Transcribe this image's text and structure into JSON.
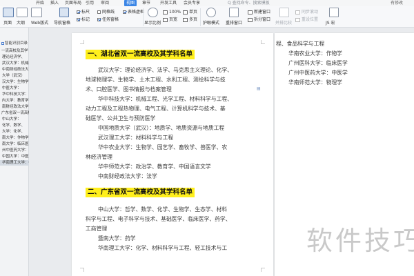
{
  "menu": {
    "items": [
      "开始",
      "插入",
      "页面布局",
      "引用",
      "审阅",
      "视图",
      "章节",
      "开发工具",
      "会员专享"
    ],
    "active_index": 5,
    "search": "Q 查找命令、搜索模板",
    "right": "有修改"
  },
  "ribbon": {
    "big_buttons": [
      "页面",
      "大纲",
      "Web版式"
    ],
    "nav_pane": "导航窗格",
    "checks": [
      "标尺",
      "网格线",
      "表格虚框",
      "标记",
      "任务窗格"
    ],
    "zoom_buttons": [
      "100%",
      "单页",
      "多页",
      "页宽"
    ],
    "display_ratio": "显示比例",
    "eye_protect": "护眼模式",
    "rearrange": "重排窗口",
    "new_window": "新建窗口",
    "split_window": "拆分窗口",
    "side_by_side": "并排比较",
    "sync_scroll": "同步滚动",
    "reset_pos": "重设位置",
    "macro": "JS 宏"
  },
  "nav": {
    "title": "智能识别目录",
    "items": [
      "一流高校及其学",
      "理论经济学、",
      "武汉大学：机械工",
      "中南财经政法大",
      "大学（武汉）",
      "汉大学：生物学",
      "中医大学：",
      "华中科技大学：",
      "内大学：教育学",
      "南财经政法大学",
      "广东省双一流高校及其",
      "中山大学：",
      "化学、数学、",
      "大学：化学、",
      "南大学：作物学",
      "南大学：临床医",
      "州中医药大学：",
      "中国大学：中医",
      "华南理工大学：物理学"
    ],
    "selected_index": 18
  },
  "doc": {
    "h1": "一、湖北省双一流高校及其学科名单",
    "h2": "二、广东省双一流高校及其学科名单",
    "p1": [
      "武汉大学：理论经济学、法学、马克思主义理论、化学、",
      "地球物理学、生物学、土木工程、水利工程、测绘科学与技",
      "术、口腔医学、图书情报与档案管理",
      "华中科技大学：机械工程、光学工程、材料科学与工程、",
      "动力工程及工程热物理、电气工程、计算机科学与技术、基",
      "础医学、公共卫生与预防医学",
      "中国地质大学（武汉）：地质学、地质资源与地质工程",
      "武汉理工大学：材料科学与工程",
      "华中农业大学：生物学、园艺学、畜牧学、兽医学、农",
      "林经济管理",
      "华中师范大学：政治学、教育学、中国语言文学",
      "中南财经政法大学：法学"
    ],
    "p2": [
      "中山大学：哲学、数学、化学、生物学、生态学、材料",
      "科学与工程、电子科学与技术、基础医学、临床医学、药学、",
      "工商管理",
      "暨南大学：药学",
      "华南理工大学：化学、材料科学与工程、轻工技术与工"
    ],
    "page2": [
      "程、食品科学与工程",
      "华南农业大学：作物学",
      "广州医科大学：临床医学",
      "广州中医药大学：中医学",
      "华南师范大学：物理学"
    ]
  },
  "watermark": "软件技巧"
}
